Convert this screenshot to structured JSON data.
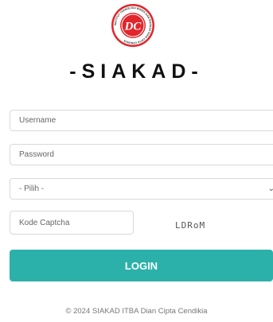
{
  "branding": {
    "app_title": "-SIAKAD-",
    "logo_initials": "DC",
    "logo_ring_text": "INSTITUT TEKNOLOGI BISNIS DAN BAHASA DIAN CIPTA CENDIKIA",
    "logo_color": "#e0262b"
  },
  "form": {
    "username_placeholder": "Username",
    "password_placeholder": "Password",
    "select_value": "- Pilih -",
    "captcha_placeholder": "Kode Captcha",
    "captcha_code": "LDRoM",
    "login_label": "LOGIN",
    "login_color": "#2cb1aa"
  },
  "footer": {
    "text": "© 2024 SIAKAD ITBA Dian Cipta Cendikia"
  }
}
